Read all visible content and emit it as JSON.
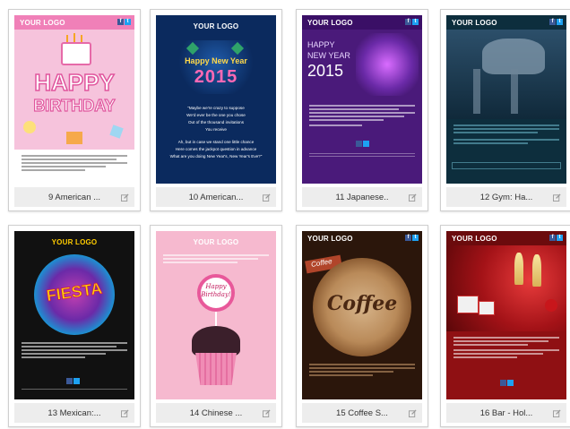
{
  "logo_text": "YOUR LOGO",
  "cards": [
    {
      "caption": "9 American ...",
      "art_text": [
        "HAPPY",
        "BIRTHDAY"
      ]
    },
    {
      "caption": "10 American...",
      "art_text": [
        "Happy New Year",
        "2015"
      ],
      "poem": [
        "\"Maybe we're crazy to suppose",
        "We'd ever be the one you chose",
        "Out of the thousand invitations",
        "You receive",
        "Ah, but in case we stand one little chance",
        "Here comes the jackpot question in advance",
        "What are you doing New Year's, New Year's Eve?\""
      ]
    },
    {
      "caption": "11 Japanese..",
      "art_text": [
        "HAPPY",
        "NEW YEAR",
        "2015"
      ]
    },
    {
      "caption": "12 Gym: Ha...",
      "art_text": []
    },
    {
      "caption": "13 Mexican:...",
      "art_text": [
        "FIESTA"
      ]
    },
    {
      "caption": "14 Chinese ...",
      "art_text": [
        "Happy",
        "Birthday!"
      ]
    },
    {
      "caption": "15 Coffee S...",
      "art_text": [
        "Coffee",
        "Coffee"
      ]
    },
    {
      "caption": "16 Bar - Hol...",
      "art_text": []
    }
  ]
}
